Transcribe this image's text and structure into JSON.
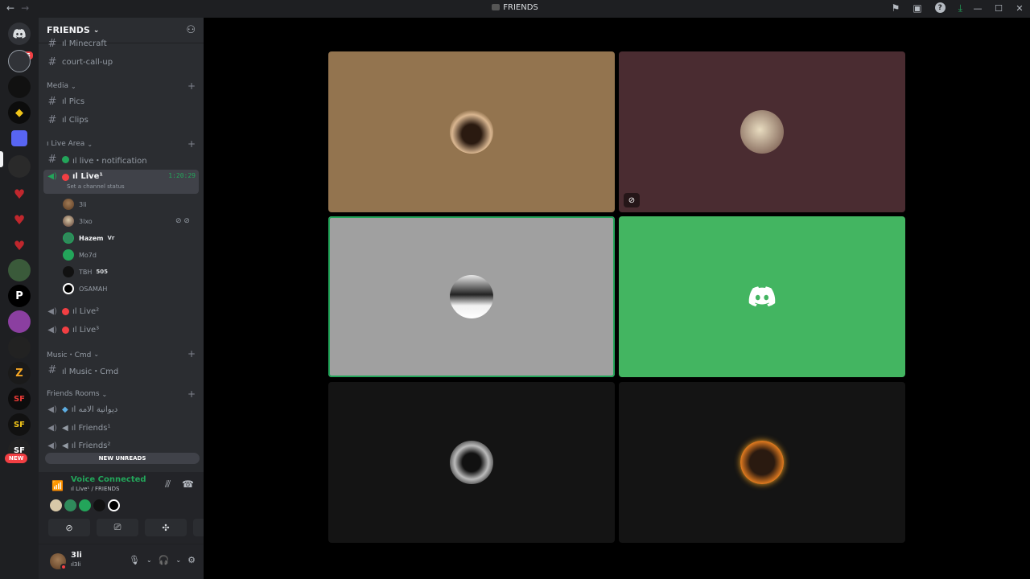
{
  "titlebar": {
    "title": "FRIENDS",
    "back": "←",
    "forward": "→",
    "actions": {
      "inbox": "⚑",
      "screen": "▣",
      "help": "?",
      "download": "⤓"
    },
    "window": {
      "minimize": "—",
      "maximize": "☐",
      "close": "✕"
    }
  },
  "rail": {
    "dm_badge": "65",
    "new_label": "NEW"
  },
  "guild": {
    "name": "FRIENDS"
  },
  "channels": {
    "minecraft": "ıl Minecraft",
    "court": "court-call-up",
    "cat_media": "Media",
    "pics": "ıl Pics",
    "clips": "ıl Clips",
    "cat_live": "ı Live Area",
    "live_notification": "ıl live・notification",
    "live1": "ıl Live¹",
    "live1_timer": "1:20:29",
    "live1_status": "Set a channel status",
    "live2": "ıl Live²",
    "live3": "ıl Live³",
    "cat_music": "Music・Cmd",
    "music_cmd": "ıl Music・Cmd",
    "cat_friends": "Friends Rooms",
    "friends_ar": "ıl دیوانیة الامه",
    "friends1": "ıl Friends¹",
    "friends2": "ıl Friends²",
    "new_unreads": "NEW UNREADS"
  },
  "members": [
    {
      "name": "3li",
      "tag": "",
      "bold": false
    },
    {
      "name": "3lxo",
      "tag": "",
      "bold": false
    },
    {
      "name": "Hazem",
      "tag": "Vr",
      "bold": true
    },
    {
      "name": "Mo7d",
      "tag": "",
      "bold": false
    },
    {
      "name": "TBH",
      "tag": "505",
      "bold": false
    },
    {
      "name": "OSAMAH",
      "tag": "",
      "bold": false
    }
  ],
  "voice": {
    "title": "Voice Connected",
    "sub": "ıl Live¹ / FRIENDS"
  },
  "user": {
    "name": "3li",
    "sub": "ıl3li"
  },
  "colors": {
    "accent_green": "#23a55a",
    "tile_brown": "#93744f",
    "tile_maroon": "#4a2c31",
    "tile_gray": "#a0a0a0",
    "tile_green": "#43b561",
    "tile_dark": "#141414"
  }
}
